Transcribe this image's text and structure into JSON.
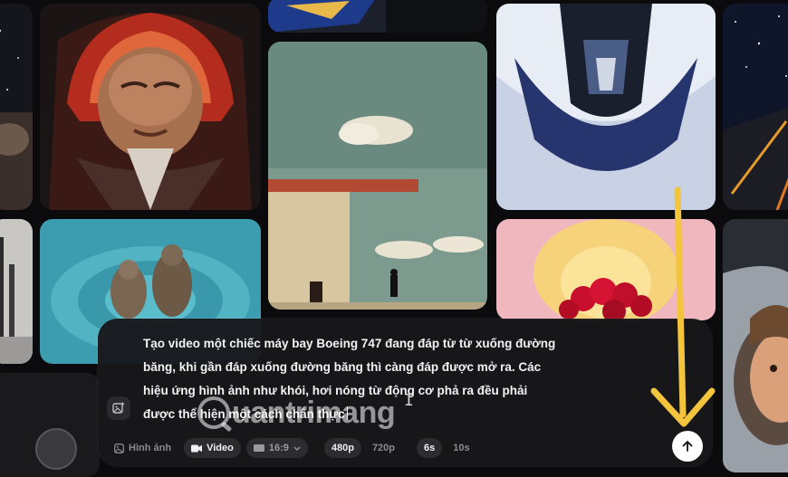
{
  "gallery": {
    "tiles": [
      {
        "id": "space-left"
      },
      {
        "id": "racer-helmet"
      },
      {
        "id": "blue-top"
      },
      {
        "id": "building-figure"
      },
      {
        "id": "armored-diver"
      },
      {
        "id": "night-highway"
      },
      {
        "id": "street-left"
      },
      {
        "id": "otters"
      },
      {
        "id": "roses"
      },
      {
        "id": "astronaut-child"
      },
      {
        "id": "dark-bottom-left"
      }
    ]
  },
  "prompt": {
    "text": "Tạo video một chiếc máy bay Boeing 747 đang đáp từ từ xuống đường băng, khi gần đáp xuống đường băng thì càng đáp được mở ra. Các hiệu ứng hình ảnh như khói, hơi nóng từ động cơ phả ra đều phải được thể hiện một cách chân thực"
  },
  "toolbar": {
    "image_label": "Hình ảnh",
    "video_label": "Video",
    "ratio_label": "16:9",
    "res_480": "480p",
    "res_720": "720p",
    "dur_6": "6s",
    "dur_10": "10s"
  },
  "watermark": {
    "text": "uantrimang"
  },
  "colors": {
    "annotation_arrow": "#f2c53d",
    "panel_bg": "#18181b"
  }
}
